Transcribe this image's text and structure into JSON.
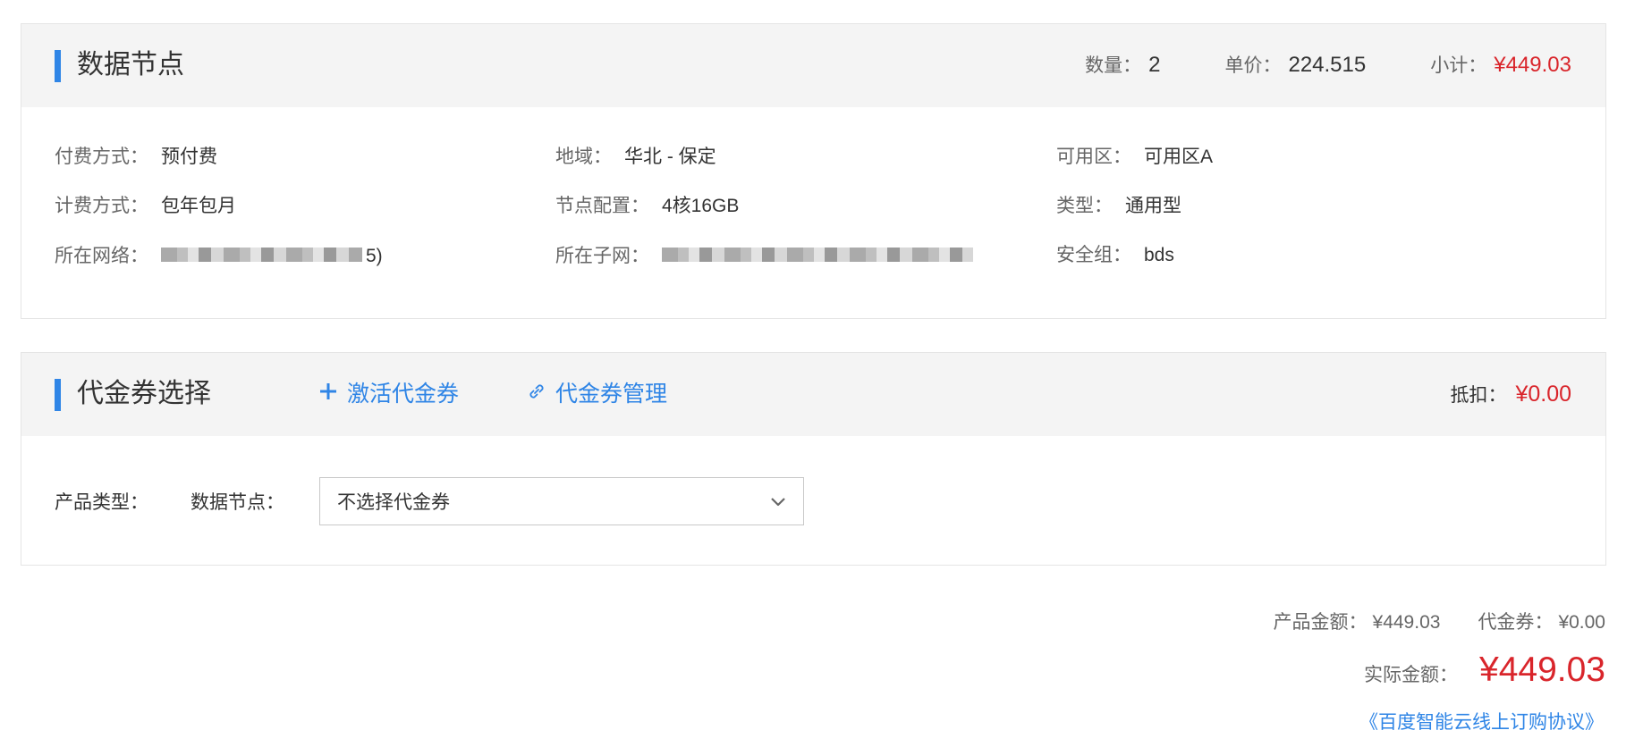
{
  "nodes_panel": {
    "title": "数据节点",
    "quantity_label": "数量",
    "quantity_value": "2",
    "unit_price_label": "单价",
    "unit_price_value": "224.515",
    "subtotal_label": "小计",
    "subtotal_value": "¥449.03",
    "info": {
      "billing_mode_label": "付费方式",
      "billing_mode_value": "预付费",
      "region_label": "地域",
      "region_value": "华北 - 保定",
      "zone_label": "可用区",
      "zone_value": "可用区A",
      "charge_type_label": "计费方式",
      "charge_type_value": "包年包月",
      "node_config_label": "节点配置",
      "node_config_value": "4核16GB",
      "type_label": "类型",
      "type_value": "通用型",
      "network_label": "所在网络",
      "network_value_tail": "5)",
      "subnet_label": "所在子网",
      "security_group_label": "安全组",
      "security_group_value": "bds"
    }
  },
  "voucher_panel": {
    "title": "代金券选择",
    "activate_label": "激活代金券",
    "manage_label": "代金券管理",
    "deduct_label": "抵扣",
    "deduct_value": "¥0.00",
    "product_type_label": "产品类型",
    "data_node_label": "数据节点",
    "select_value": "不选择代金券"
  },
  "summary": {
    "product_amount_label": "产品金额",
    "product_amount_value": "¥449.03",
    "voucher_label": "代金券",
    "voucher_value": "¥0.00",
    "actual_amount_label": "实际金额",
    "actual_amount_value": "¥449.03",
    "agreement_link": "《百度智能云线上订购协议》"
  },
  "colors": {
    "accent": "#2f85e6",
    "price_red": "#d9252b",
    "header_bg": "#f4f4f4"
  },
  "icons": [
    "plus-icon",
    "link-icon",
    "chevron-down-icon"
  ]
}
